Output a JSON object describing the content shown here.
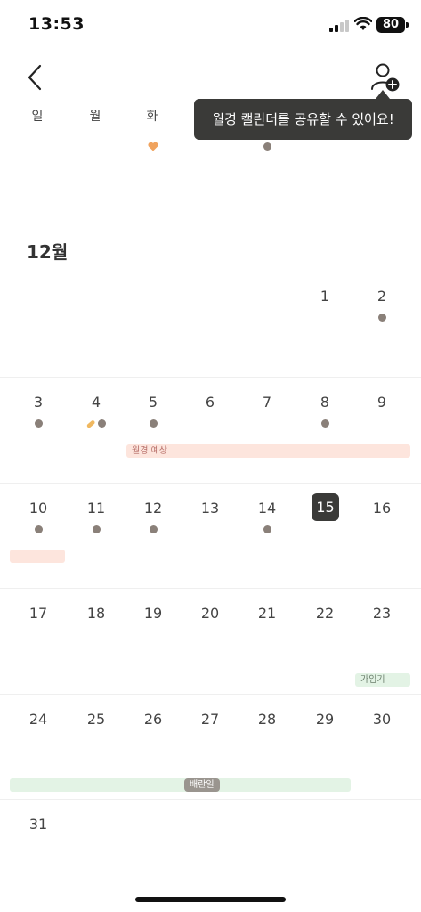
{
  "status_bar": {
    "time": "13:53",
    "battery": "80"
  },
  "tooltip": {
    "text": "월경 캘린더를 공유할 수 있어요!"
  },
  "weekdays": [
    "일",
    "월",
    "화"
  ],
  "month": {
    "title": "12월"
  },
  "weeks": [
    {
      "days": [
        "",
        "",
        "",
        "",
        "",
        "1",
        "2"
      ]
    },
    {
      "days": [
        "3",
        "4",
        "5",
        "6",
        "7",
        "8",
        "9"
      ]
    },
    {
      "days": [
        "10",
        "11",
        "12",
        "13",
        "14",
        "15",
        "16"
      ]
    },
    {
      "days": [
        "17",
        "18",
        "19",
        "20",
        "21",
        "22",
        "23"
      ]
    },
    {
      "days": [
        "24",
        "25",
        "26",
        "27",
        "28",
        "29",
        "30"
      ]
    },
    {
      "days": [
        "31",
        "",
        "",
        "",
        "",
        "",
        ""
      ]
    }
  ],
  "today": "15",
  "bands": {
    "period_expected": "월경 예상",
    "fertile": "가임기",
    "ovulation": "배란일"
  },
  "colors": {
    "dot": "#8a8079",
    "today_bg": "#3a3a38",
    "period_band": "#fde5dd",
    "fertile_band": "#e3f3e5",
    "heart": "#f0a35e"
  },
  "icons": {
    "back": "chevron-left-icon",
    "share": "person-add-icon",
    "heart": "heart-icon",
    "pill": "pill-icon"
  }
}
